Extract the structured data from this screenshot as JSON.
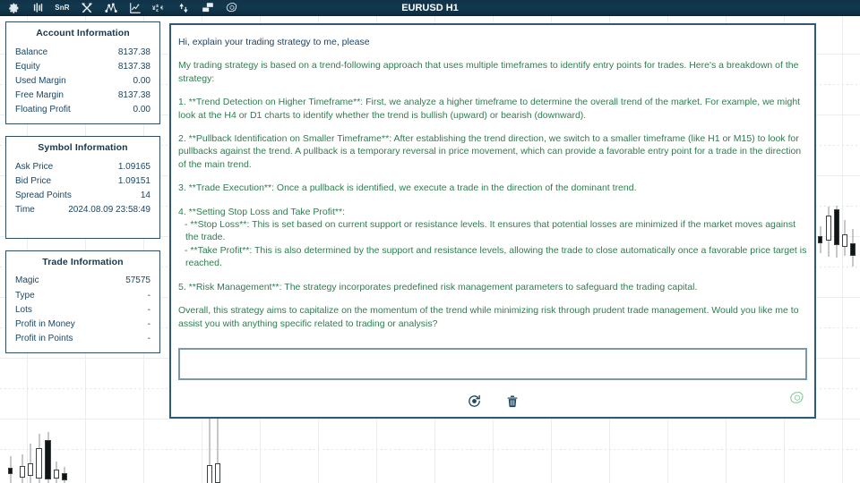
{
  "toolbar": {
    "title": "EURUSD H1",
    "buttons": [
      {
        "name": "settings-gear-icon",
        "label": "",
        "icon": "gear"
      },
      {
        "name": "bars-indicator-icon",
        "label": "",
        "icon": "bars"
      },
      {
        "name": "snr-button",
        "label": "SnR",
        "icon": "text"
      },
      {
        "name": "tools-crossed-icon",
        "label": "",
        "icon": "tools"
      },
      {
        "name": "zigzag-points-icon",
        "label": "",
        "icon": "zigzag"
      },
      {
        "name": "line-chart-icon",
        "label": "",
        "icon": "linechart"
      },
      {
        "name": "currency-symbols-icon",
        "label": "",
        "icon": "currency"
      },
      {
        "name": "arrows-updown-icon",
        "label": "",
        "icon": "arrows"
      },
      {
        "name": "panels-icon",
        "label": "",
        "icon": "panels"
      },
      {
        "name": "openai-logo-icon",
        "label": "",
        "icon": "openai"
      }
    ]
  },
  "account_panel": {
    "title": "Account Information",
    "rows": [
      {
        "label": "Balance",
        "value": "8137.38"
      },
      {
        "label": "Equity",
        "value": "8137.38"
      },
      {
        "label": "Used Margin",
        "value": "0.00"
      },
      {
        "label": "Free Margin",
        "value": "8137.38"
      },
      {
        "label": "Floating Profit",
        "value": "0.00"
      }
    ]
  },
  "symbol_panel": {
    "title": "Symbol Information",
    "rows": [
      {
        "label": "Ask Price",
        "value": "1.09165"
      },
      {
        "label": "Bid Price",
        "value": "1.09151"
      },
      {
        "label": "Spread Points",
        "value": "14"
      },
      {
        "label": "Time",
        "value": "2024.08.09 23:58:49"
      }
    ]
  },
  "trade_panel": {
    "title": "Trade Information",
    "rows": [
      {
        "label": "Magic",
        "value": "57575"
      },
      {
        "label": "Type",
        "value": "-"
      },
      {
        "label": "Lots",
        "value": "-"
      },
      {
        "label": "Profit in Money",
        "value": "-"
      },
      {
        "label": "Profit in Points",
        "value": "-"
      }
    ]
  },
  "chat": {
    "user_message": "Hi, explain your trading strategy to me, please",
    "ai_paragraphs": [
      "My trading strategy is based on a trend-following approach that uses multiple timeframes to identify entry points for trades. Here's a breakdown of the strategy:",
      "1. **Trend Detection on Higher Timeframe**: First, we analyze a higher timeframe to determine the overall trend of the market. For example, we might look at the H4 or D1 charts to identify whether the trend is bullish (upward) or bearish (downward).",
      "2. **Pullback Identification on Smaller Timeframe**: After establishing the trend direction, we switch to a smaller timeframe (like H1 or M15) to look for pullbacks against the trend. A pullback is a temporary reversal in price movement, which can provide a favorable entry point for a trade in the direction of the main trend.",
      "3. **Trade Execution**: Once a pullback is identified, we execute a trade in the direction of the dominant trend.",
      "4. **Setting Stop Loss and Take Profit**:",
      "   - **Stop Loss**: This is set based on current support or resistance levels. It ensures that potential losses are minimized if the market moves against the trade.",
      "   - **Take Profit**: This is also determined by the support and resistance levels, allowing the trade to close automatically once a favorable price target is reached.",
      "5. **Risk Management**: The strategy incorporates predefined risk management parameters to safeguard the trading capital.",
      "Overall, this strategy aims to capitalize on the momentum of the trend while minimizing risk through prudent trade management. Would you like me to assist you with anything specific related to trading or analysis?"
    ],
    "input_value": "",
    "input_placeholder": "",
    "actions": [
      {
        "name": "refresh-button",
        "icon": "refresh"
      },
      {
        "name": "delete-button",
        "icon": "trash"
      }
    ],
    "brand": {
      "name": "openai-logo-icon"
    }
  },
  "colors": {
    "toolbar_bg": "#123247",
    "panel_border": "#2e4d63",
    "panel_text": "#1d4560",
    "chat_border": "#2e5a78",
    "user_text": "#1c4566",
    "ai_text": "#2e7d4f",
    "brand_green": "#7fc99b",
    "grid": "#ebedee"
  },
  "chart_data": {
    "type": "candlestick",
    "symbol": "EURUSD",
    "timeframe": "H1",
    "right_cluster": [
      {
        "o": 0.5,
        "h": 0.58,
        "l": 0.44,
        "c": 0.52,
        "dir": "down"
      },
      {
        "o": 0.34,
        "h": 0.86,
        "l": 0.3,
        "c": 0.74,
        "dir": "up"
      },
      {
        "o": 0.76,
        "h": 0.88,
        "l": 0.4,
        "c": 0.42,
        "dir": "down"
      },
      {
        "o": 0.44,
        "h": 0.62,
        "l": 0.36,
        "c": 0.4,
        "dir": "up"
      },
      {
        "o": 0.4,
        "h": 0.5,
        "l": 0.26,
        "c": 0.32,
        "dir": "down"
      },
      {
        "o": 0.32,
        "h": 0.36,
        "l": 0.1,
        "c": 0.14,
        "dir": "down"
      }
    ],
    "bottom_left_cluster": [
      {
        "o": 0.1,
        "h": 0.22,
        "l": 0.02,
        "c": 0.08,
        "dir": "down"
      },
      {
        "o": 0.12,
        "h": 0.26,
        "l": 0.06,
        "c": 0.16,
        "dir": "up"
      },
      {
        "o": 0.16,
        "h": 0.42,
        "l": 0.1,
        "c": 0.2,
        "dir": "up"
      },
      {
        "o": 0.22,
        "h": 0.6,
        "l": 0.14,
        "c": 0.5,
        "dir": "up"
      },
      {
        "o": 0.52,
        "h": 0.66,
        "l": 0.1,
        "c": 0.16,
        "dir": "down"
      },
      {
        "o": 0.14,
        "h": 0.2,
        "l": 0.04,
        "c": 0.1,
        "dir": "up"
      },
      {
        "o": 0.1,
        "h": 0.16,
        "l": 0.02,
        "c": 0.06,
        "dir": "down"
      }
    ],
    "center_cluster": [
      {
        "o": 0.3,
        "h": 0.95,
        "l": 0.05,
        "c": 0.2,
        "dir": "up"
      },
      {
        "o": 0.25,
        "h": 0.99,
        "l": 0.02,
        "c": 0.14,
        "dir": "up"
      }
    ]
  }
}
